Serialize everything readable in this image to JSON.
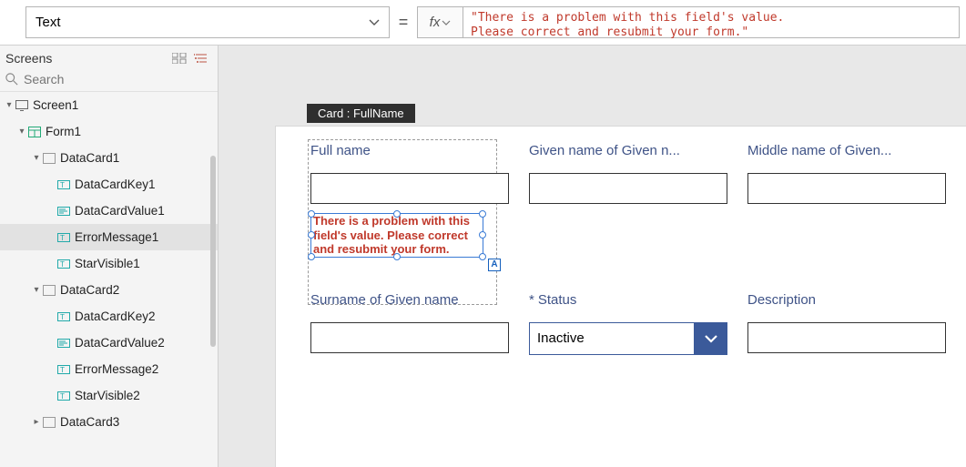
{
  "formula_bar": {
    "property": "Text",
    "fx_label": "fx",
    "value": "\"There is a problem with this field's value.\nPlease correct and resubmit your form.\""
  },
  "screens_panel": {
    "title": "Screens",
    "search_placeholder": "Search"
  },
  "tree": [
    {
      "id": "screen1",
      "label": "Screen1",
      "indent": 0,
      "icon": "screen",
      "expanded": true
    },
    {
      "id": "form1",
      "label": "Form1",
      "indent": 1,
      "icon": "form",
      "expanded": true
    },
    {
      "id": "dc1",
      "label": "DataCard1",
      "indent": 2,
      "icon": "card",
      "expanded": true
    },
    {
      "id": "dck1",
      "label": "DataCardKey1",
      "indent": 3,
      "icon": "text"
    },
    {
      "id": "dcv1",
      "label": "DataCardValue1",
      "indent": 3,
      "icon": "value"
    },
    {
      "id": "em1",
      "label": "ErrorMessage1",
      "indent": 3,
      "icon": "text",
      "selected": true
    },
    {
      "id": "sv1",
      "label": "StarVisible1",
      "indent": 3,
      "icon": "text"
    },
    {
      "id": "dc2",
      "label": "DataCard2",
      "indent": 2,
      "icon": "card",
      "expanded": true
    },
    {
      "id": "dck2",
      "label": "DataCardKey2",
      "indent": 3,
      "icon": "text"
    },
    {
      "id": "dcv2",
      "label": "DataCardValue2",
      "indent": 3,
      "icon": "value"
    },
    {
      "id": "em2",
      "label": "ErrorMessage2",
      "indent": 3,
      "icon": "text"
    },
    {
      "id": "sv2",
      "label": "StarVisible2",
      "indent": 3,
      "icon": "text"
    },
    {
      "id": "dc3",
      "label": "DataCard3",
      "indent": 2,
      "icon": "card",
      "expanded": false
    }
  ],
  "canvas": {
    "card_tooltip": "Card : FullName",
    "error_text": "There is a problem with this field's value.  Please correct and resubmit your form.",
    "selected_badge": "A",
    "fields": {
      "fullname": {
        "label": "Full name"
      },
      "givenname": {
        "label": "Given name of Given n..."
      },
      "middlename": {
        "label": "Middle name of Given..."
      },
      "surname": {
        "label": "Surname of Given name"
      },
      "status": {
        "label": "Status",
        "required": true,
        "value": "Inactive"
      },
      "description": {
        "label": "Description"
      }
    }
  }
}
